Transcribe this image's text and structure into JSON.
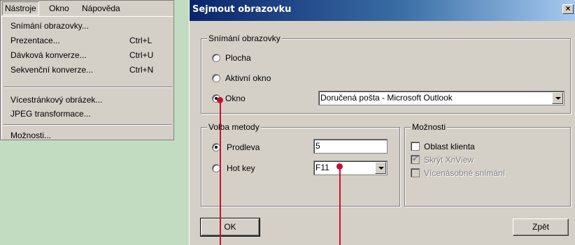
{
  "menu": {
    "bar": [
      "Nástroje",
      "Okno",
      "Nápověda"
    ],
    "items": [
      {
        "label": "Snímání obrazovky...",
        "shortcut": ""
      },
      {
        "label": "Prezentace...",
        "shortcut": "Ctrl+L"
      },
      {
        "label": "Dávková konverze...",
        "shortcut": "Ctrl+U"
      },
      {
        "label": "Sekvenční konverze...",
        "shortcut": "Ctrl+N"
      },
      {
        "label": "Vícestránkový obrázek...",
        "shortcut": ""
      },
      {
        "label": "JPEG transformace...",
        "shortcut": ""
      },
      {
        "label": "Možnosti...",
        "shortcut": ""
      }
    ]
  },
  "dialog": {
    "title": "Sejmout obrazovku",
    "close": "×",
    "capture": {
      "legend": "Snímání obrazovky",
      "options": [
        "Plocha",
        "Aktivní okno",
        "Okno"
      ],
      "selected": "Okno",
      "window_value": "Doručená pošta - Microsoft Outlook"
    },
    "method": {
      "legend": "Volba metody",
      "delay_label": "Prodleva",
      "delay_value": "5",
      "hotkey_label": "Hot key",
      "hotkey_value": "F11",
      "selected": "Prodleva"
    },
    "options": {
      "legend": "Možnosti",
      "items": [
        {
          "label": "Oblast klienta",
          "checked": false,
          "disabled": false
        },
        {
          "label": "Skrýt XnView",
          "checked": true,
          "disabled": true
        },
        {
          "label": "Vícenásobné snímání",
          "checked": false,
          "disabled": true
        }
      ]
    },
    "ok_label": "OK",
    "back_label": "Zpět"
  },
  "colors": {
    "annotation": "#c8102e",
    "title_gradient_start": "#0a246a"
  }
}
